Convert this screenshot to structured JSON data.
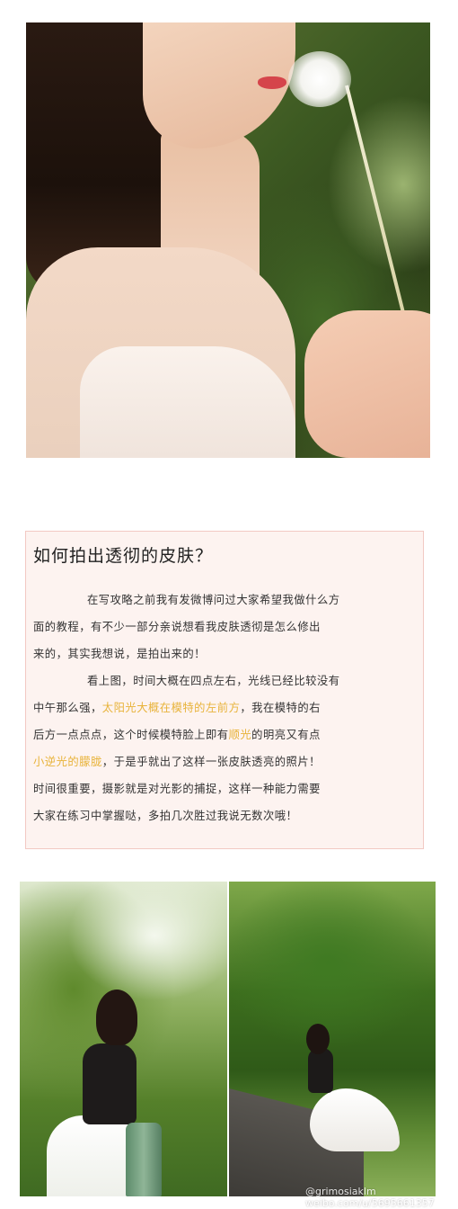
{
  "article": {
    "title": "如何拍出透彻的皮肤？",
    "paragraphs": [
      [
        {
          "text": "在写攻略之前我有发微博问过大家希望我做什么方"
        }
      ],
      [
        {
          "text": "面的教程，有不少一部分亲说想看我皮肤透彻是怎么修出"
        }
      ],
      [
        {
          "text": "来的，其实我想说，是拍出来的！"
        }
      ],
      [
        {
          "text": "看上图，时间大概在四点左右，光线已经比较没有"
        }
      ],
      [
        {
          "text": "中午那么强，"
        },
        {
          "text": "太阳光大概在模特的左前方",
          "highlight": true
        },
        {
          "text": "，我在模特的右"
        }
      ],
      [
        {
          "text": "后方一点点点，这个时候模特脸上即有"
        },
        {
          "text": "顺光",
          "highlight": true
        },
        {
          "text": "的明亮又有点"
        }
      ],
      [
        {
          "text": "小逆光的朦胧",
          "highlight": true
        },
        {
          "text": "，于是乎就出了这样一张皮肤透亮的照片！"
        }
      ],
      [
        {
          "text": "时间很重要，摄影就是对光影的捕捉，这样一种能力需要"
        }
      ],
      [
        {
          "text": "大家在练习中掌握哒，多拍几次胜过我说无数次哦！"
        }
      ]
    ],
    "highlight_color": "#e8b33a"
  },
  "images": {
    "hero": "portrait-dandelion-photo",
    "left": "girl-with-kettle-photo",
    "right": "girl-sitting-on-wall-photo"
  },
  "watermark": {
    "line1": "@grimosiaklm",
    "line2": "weibo.com/u/5695661357"
  }
}
